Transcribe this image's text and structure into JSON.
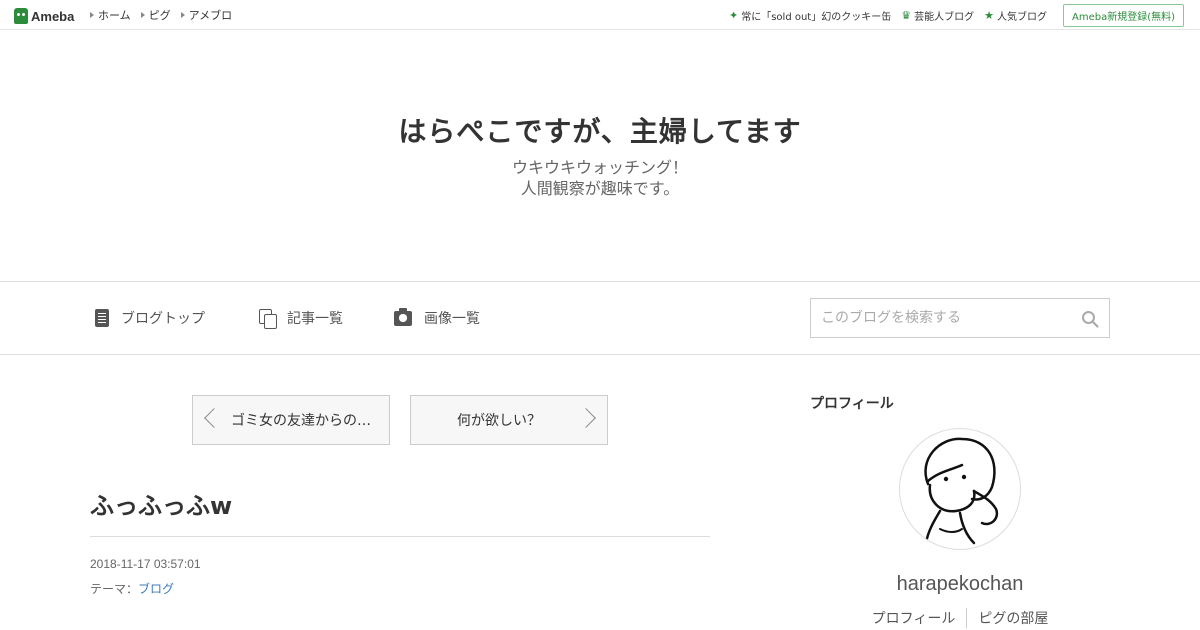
{
  "topbar": {
    "logo": "Ameba",
    "nav": [
      "ホーム",
      "ピグ",
      "アメブロ"
    ],
    "links": [
      {
        "icon": "sparkle-icon",
        "label": "常に「sold out」幻のクッキー缶"
      },
      {
        "icon": "crown-icon",
        "label": "芸能人ブログ"
      },
      {
        "icon": "star-icon",
        "label": "人気ブログ"
      }
    ],
    "register": "Ameba新規登録(無料)",
    "accent": "#2d8c3c"
  },
  "header": {
    "title": "はらぺこですが、主婦してます",
    "description_line1": "ウキウキウォッチング！",
    "description_line2": "人間観察が趣味です。"
  },
  "gnav": {
    "blog_top": "ブログトップ",
    "articles": "記事一覧",
    "images": "画像一覧",
    "search_placeholder": "このブログを検索する"
  },
  "pager": {
    "prev": "ゴミ女の友達からの…",
    "next": "何が欲しい？"
  },
  "entry": {
    "title": "ふっふっふw",
    "date": "2018-11-17 03:57:01",
    "theme_label": "テーマ：",
    "theme_value": "ブログ"
  },
  "sidebar": {
    "heading": "プロフィール",
    "username": "harapekochan",
    "links": [
      "プロフィール",
      "ピグの部屋"
    ]
  }
}
